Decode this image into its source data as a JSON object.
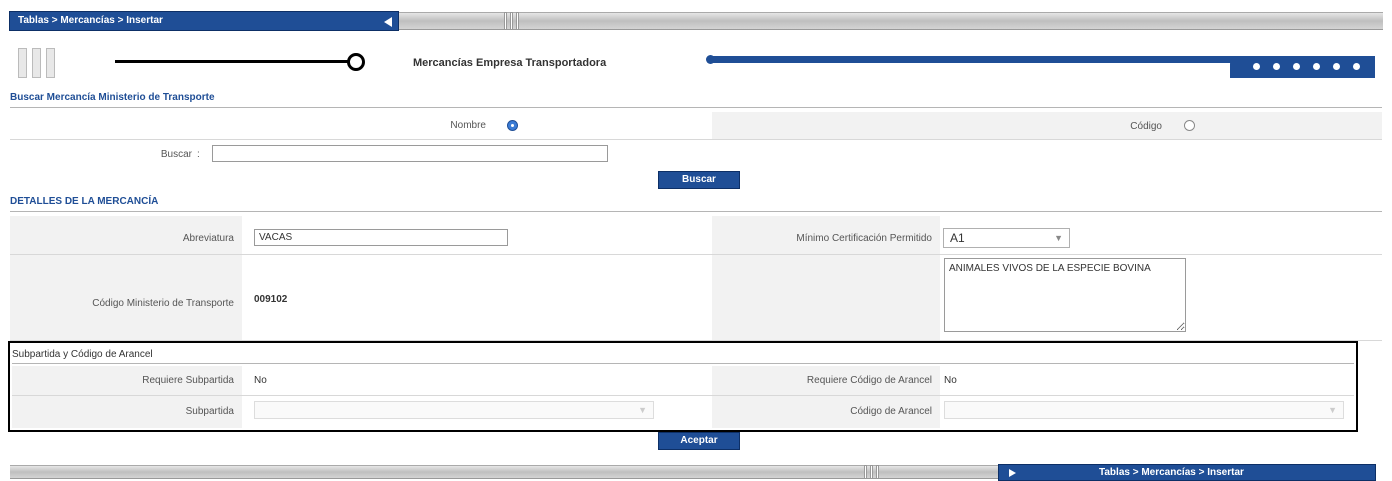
{
  "header": {
    "breadcrumb": "Tablas > Mercancías > Insertar",
    "tab_title": "Mercancías Empresa Transportadora"
  },
  "search_section": {
    "title": "Buscar Mercancía Ministerio de Transporte",
    "radio_nombre_label": "Nombre",
    "radio_codigo_label": "Código",
    "selected": "nombre",
    "search_label": "Buscar",
    "search_value": "",
    "search_button": "Buscar"
  },
  "details_section": {
    "title": "DETALLES DE LA MERCANCÍA",
    "abreviatura_label": "Abreviatura",
    "abreviatura_value": "VACAS",
    "minimo_label": "Mínimo Certificación Permitido",
    "minimo_value": "A1",
    "codigo_label": "Código Ministerio de Transporte",
    "codigo_value": "009102",
    "descripcion_value": "ANIMALES VIVOS DE LA ESPECIE BOVINA"
  },
  "subpartida_section": {
    "title": "Subpartida y Código de Arancel",
    "requiere_subpartida_label": "Requiere Subpartida",
    "requiere_subpartida_value": "No",
    "requiere_codigo_label": "Requiere Código de Arancel",
    "requiere_codigo_value": "No",
    "subpartida_label": "Subpartida",
    "subpartida_value": "",
    "codigo_arancel_label": "Código de Arancel",
    "codigo_arancel_value": ""
  },
  "footer": {
    "accept_button": "Aceptar",
    "breadcrumb": "Tablas > Mercancías > Insertar"
  },
  "colors": {
    "brand": "#1f4e96",
    "radio_selected": "#3a7bd5"
  }
}
